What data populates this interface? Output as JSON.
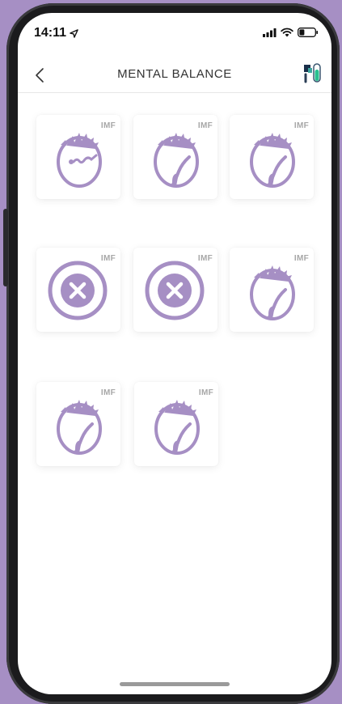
{
  "status_bar": {
    "time": "14:11",
    "location_icon": "location-arrow-icon",
    "signal_icon": "cellular-signal-icon",
    "wifi_icon": "wifi-icon",
    "battery_icon": "battery-icon"
  },
  "header": {
    "title": "MENTAL BALANCE",
    "back_icon": "chevron-left-icon",
    "logo_icon": "brand-logo-icon"
  },
  "cards": [
    {
      "badge": "IMF",
      "icon": "face-wavy-line-icon",
      "state": "face"
    },
    {
      "badge": "IMF",
      "icon": "face-curl-icon",
      "state": "face"
    },
    {
      "badge": "IMF",
      "icon": "face-curl-icon",
      "state": "face"
    },
    {
      "badge": "IMF",
      "icon": "circle-x-icon",
      "state": "blocked"
    },
    {
      "badge": "IMF",
      "icon": "circle-x-icon",
      "state": "blocked"
    },
    {
      "badge": "IMF",
      "icon": "face-curl-icon",
      "state": "face"
    },
    {
      "badge": "IMF",
      "icon": "face-curl-icon",
      "state": "face"
    },
    {
      "badge": "IMF",
      "icon": "face-curl-icon",
      "state": "face"
    }
  ],
  "colors": {
    "accent_purple": "#a68fc4",
    "badge_gray": "#a7a7a7"
  }
}
